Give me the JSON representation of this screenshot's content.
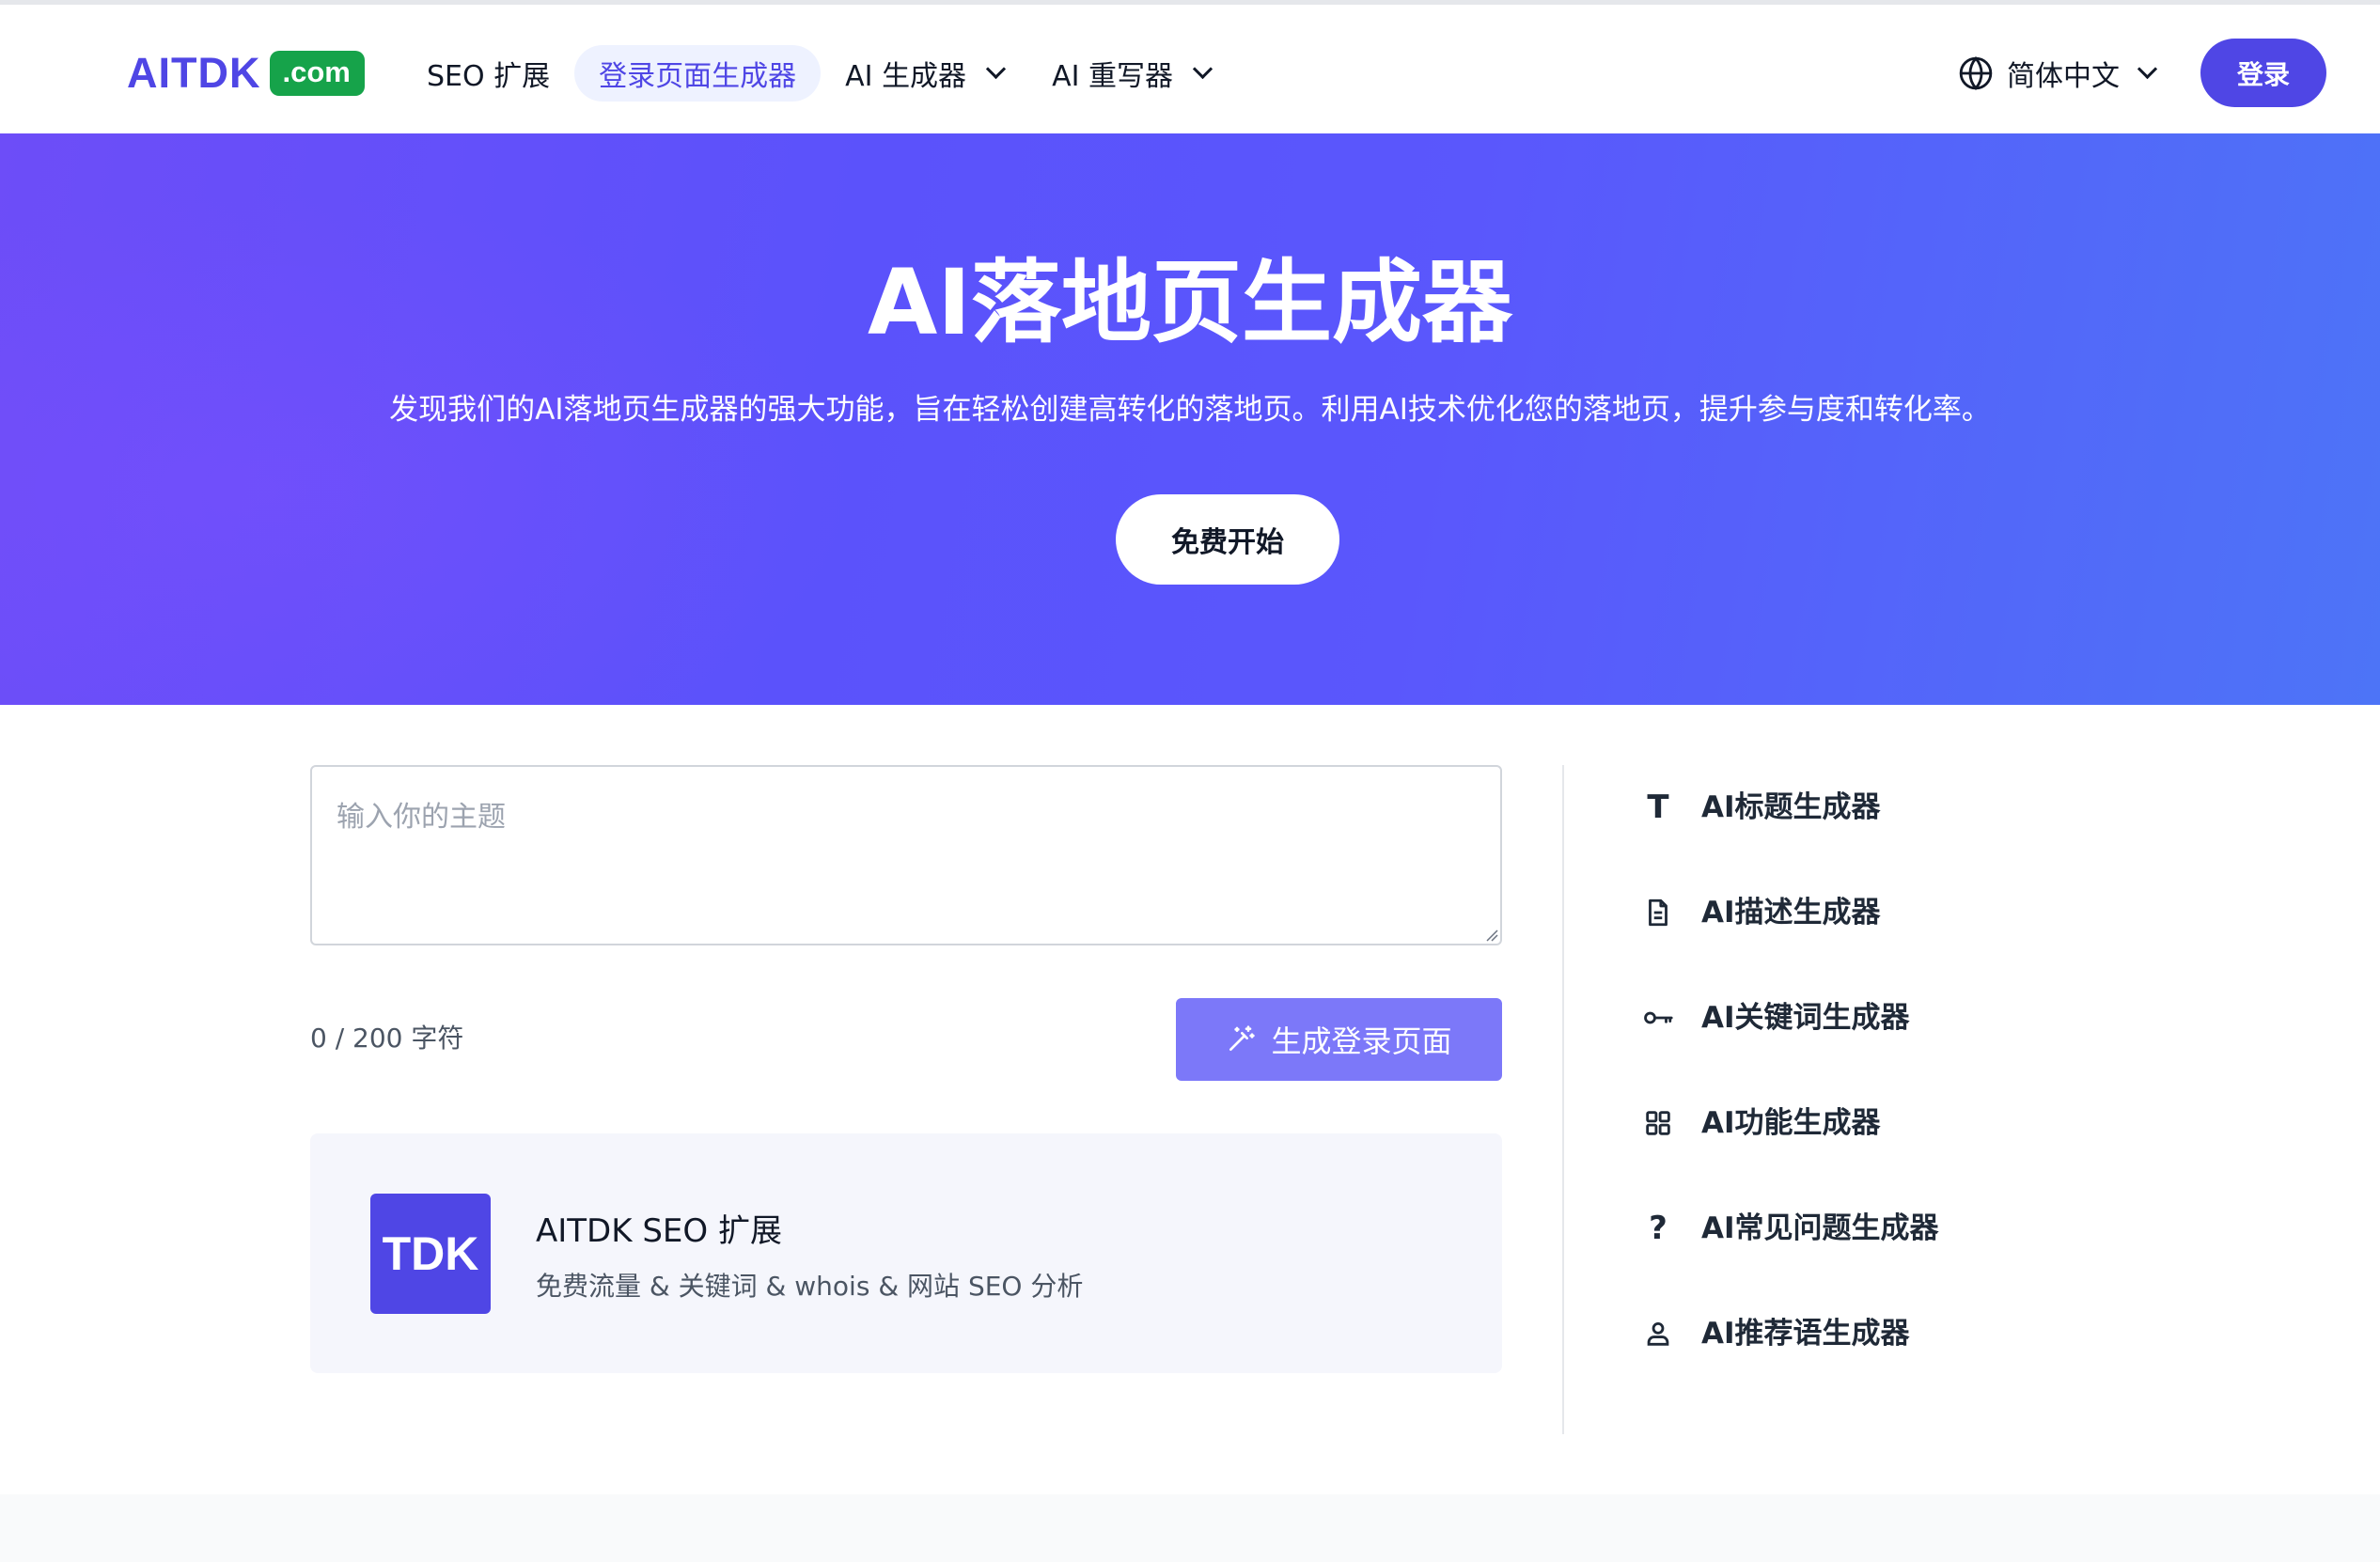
{
  "header": {
    "logo_text": "AITDK",
    "logo_badge": ".com",
    "nav": [
      {
        "label": "SEO 扩展"
      },
      {
        "label": "登录页面生成器"
      },
      {
        "label": "AI 生成器"
      },
      {
        "label": "AI 重写器"
      }
    ],
    "language": "简体中文",
    "login_label": "登录"
  },
  "hero": {
    "title": "AI落地页生成器",
    "subtitle": "发现我们的AI落地页生成器的强大功能，旨在轻松创建高转化的落地页。利用AI技术优化您的落地页，提升参与度和转化率。",
    "cta_label": "免费开始"
  },
  "form": {
    "placeholder": "输入你的主题",
    "char_count": "0 / 200 字符",
    "generate_label": "生成登录页面"
  },
  "promo": {
    "logo_text": "TDK",
    "title": "AITDK SEO 扩展",
    "description": "免费流量 & 关键词 & whois & 网站 SEO 分析"
  },
  "sidebar": {
    "items": [
      {
        "label": "AI标题生成器",
        "icon": "title-t-icon",
        "glyph": "T"
      },
      {
        "label": "AI描述生成器",
        "icon": "document-icon"
      },
      {
        "label": "AI关键词生成器",
        "icon": "key-icon"
      },
      {
        "label": "AI功能生成器",
        "icon": "grid-icon"
      },
      {
        "label": "AI常见问题生成器",
        "icon": "question-icon",
        "glyph": "?"
      },
      {
        "label": "AI推荐语生成器",
        "icon": "user-icon"
      }
    ]
  },
  "colors": {
    "brand": "#4f46e5",
    "badge_green": "#16a34a",
    "generate_button": "#7c78f9"
  }
}
